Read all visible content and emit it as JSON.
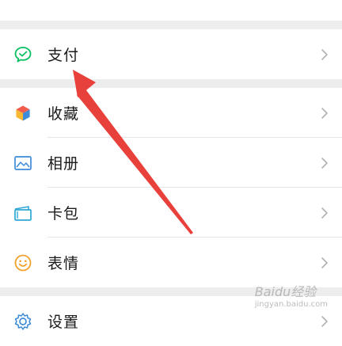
{
  "menu": {
    "pay": {
      "label": "支付",
      "icon": "wechat-pay-icon"
    },
    "favorites": {
      "label": "收藏",
      "icon": "favorites-cube-icon"
    },
    "album": {
      "label": "相册",
      "icon": "album-icon"
    },
    "cards": {
      "label": "卡包",
      "icon": "card-wallet-icon"
    },
    "stickers": {
      "label": "表情",
      "icon": "smiley-icon"
    },
    "settings": {
      "label": "设置",
      "icon": "gear-icon"
    }
  },
  "watermark": {
    "text": "Baidu经验",
    "sub": "jingyan.baidu.com"
  },
  "colors": {
    "background": "#ededed",
    "row": "#ffffff",
    "text": "#1a1a1a",
    "chevron": "#b2b2b2",
    "pay_green": "#07c160",
    "arrow_red": "#e8403a"
  }
}
